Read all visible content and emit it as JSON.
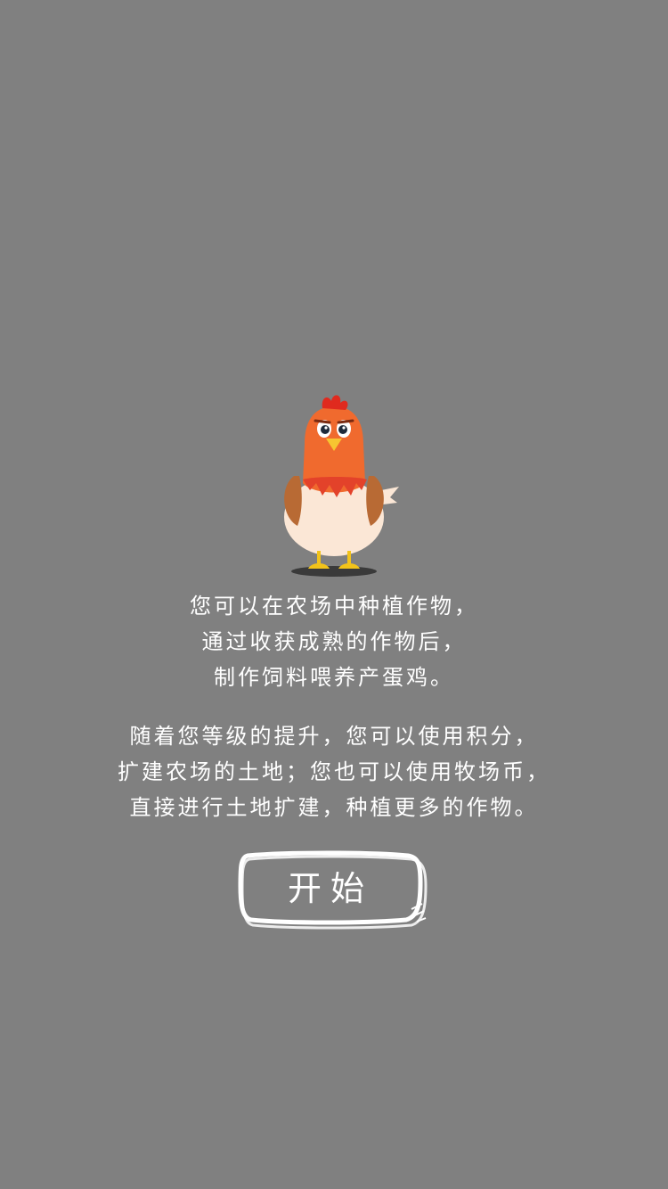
{
  "intro": {
    "paragraph1": [
      "您可以在农场中种植作物，",
      "通过收获成熟的作物后，",
      "制作饲料喂养产蛋鸡。"
    ],
    "paragraph2": [
      "随着您等级的提升，您可以使用积分，",
      "扩建农场的土地；您也可以使用牧场币，",
      "直接进行土地扩建，种植更多的作物。"
    ]
  },
  "start_button": {
    "label": "开始"
  },
  "colors": {
    "background": "#808080",
    "text": "#ffffff",
    "hen_head": "#f06a2e",
    "hen_body": "#fbe7d6",
    "hen_wing": "#b86a34",
    "hen_feet": "#f2c31a"
  },
  "icons": {
    "mascot": "hen-mascot-icon"
  }
}
